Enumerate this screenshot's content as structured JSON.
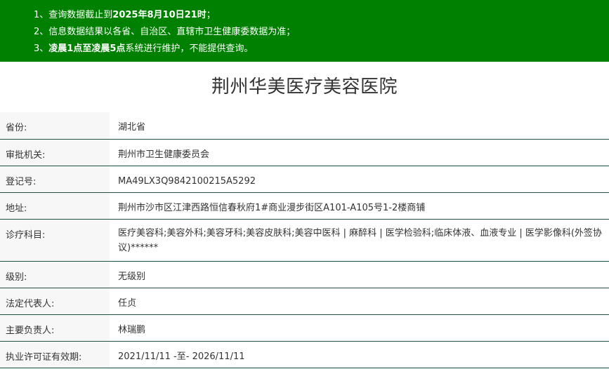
{
  "notice": {
    "lines": [
      {
        "num": "1、",
        "prefix": "查询数据截止到",
        "bold": "2025年8月10日21时",
        "suffix": "；"
      },
      {
        "num": "2、",
        "prefix": "信息数据结果以各省、自治区、直辖市卫生健康委数据为准；",
        "bold": "",
        "suffix": ""
      },
      {
        "num": "3、",
        "prefix": "",
        "bold": "凌晨1点至凌晨5点",
        "suffix": "系统进行维护，不能提供查询。"
      }
    ]
  },
  "title": "荆州华美医疗美容医院",
  "rows": [
    {
      "label": "省份:",
      "value": "湖北省"
    },
    {
      "label": "审批机关:",
      "value": "荆州市卫生健康委员会"
    },
    {
      "label": "登记号:",
      "value": "MA49LX3Q9842100215A5292"
    },
    {
      "label": "地址:",
      "value": "荆州市沙市区江津西路恒信春秋府1#商业漫步街区A101-A105号1-2楼商铺"
    },
    {
      "label": "诊疗科目:",
      "value": "医疗美容科;美容外科;美容牙科;美容皮肤科;美容中医科 | 麻醉科 | 医学检验科;临床体液、血液专业 | 医学影像科(外签协议)******"
    },
    {
      "label": "级别:",
      "value": "无级别"
    },
    {
      "label": "法定代表人:",
      "value": "任贞"
    },
    {
      "label": "主要负责人:",
      "value": "林瑞鹏"
    },
    {
      "label": "执业许可证有效期:",
      "value": "2021/11/11 -至- 2026/11/11"
    }
  ]
}
